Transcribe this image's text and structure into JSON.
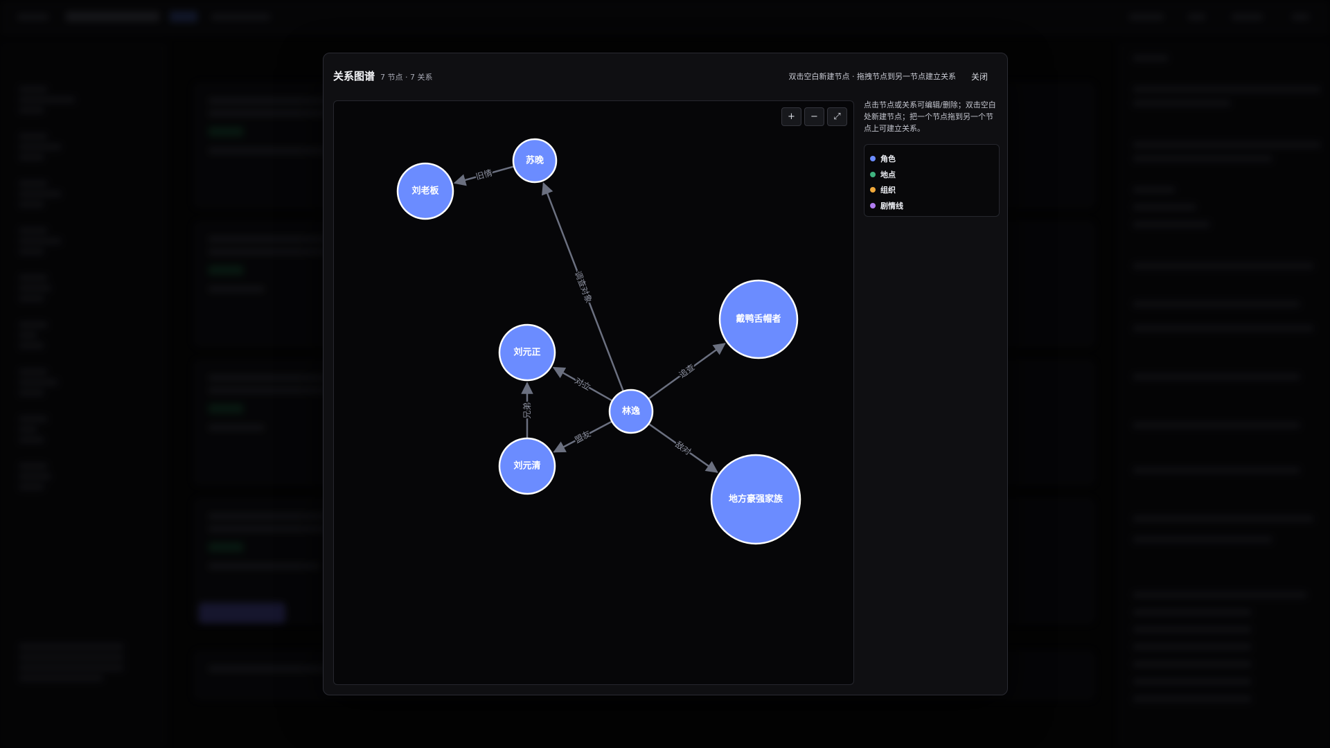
{
  "modal": {
    "title": "关系图谱",
    "count": "7 节点 · 7 关系",
    "hint": "双击空白新建节点 · 拖拽节点到另一节点建立关系",
    "close_label": "关闭"
  },
  "zoom": {
    "in_label": "+",
    "out_label": "−",
    "fit_label": "⤢"
  },
  "side": {
    "hint": "点击节点或关系可编辑/删除；双击空白处新建节点；把一个节点拖到另一个节点上可建立关系。"
  },
  "legend": [
    {
      "label": "角色",
      "color": "#6b8cff"
    },
    {
      "label": "地点",
      "color": "#3fb37f"
    },
    {
      "label": "组织",
      "color": "#f0a93b"
    },
    {
      "label": "剧情线",
      "color": "#b07cf0"
    }
  ],
  "graph": {
    "node_fill": "#6b8cff",
    "node_stroke": "#ffffff",
    "edge_color": "#6b7080",
    "nodes": [
      {
        "id": "suwan",
        "label": "苏晚"
      },
      {
        "id": "liulaoban",
        "label": "刘老板"
      },
      {
        "id": "liuyuanzheng",
        "label": "刘元正"
      },
      {
        "id": "linyi",
        "label": "林逸"
      },
      {
        "id": "liuyuanqing",
        "label": "刘元清"
      },
      {
        "id": "daiya",
        "label": "戴鸭舌帽者"
      },
      {
        "id": "difang",
        "label": "地方豪强家族"
      }
    ],
    "edges": [
      {
        "from": "suwan",
        "to": "liulaoban",
        "label": "旧情"
      },
      {
        "from": "linyi",
        "to": "suwan",
        "label": "调查对象"
      },
      {
        "from": "linyi",
        "to": "liuyuanzheng",
        "label": "对立"
      },
      {
        "from": "liuyuanqing",
        "to": "liuyuanzheng",
        "label": "兄弟"
      },
      {
        "from": "linyi",
        "to": "liuyuanqing",
        "label": "盟友"
      },
      {
        "from": "linyi",
        "to": "daiya",
        "label": "追查"
      },
      {
        "from": "linyi",
        "to": "difang",
        "label": "敌对"
      }
    ]
  }
}
